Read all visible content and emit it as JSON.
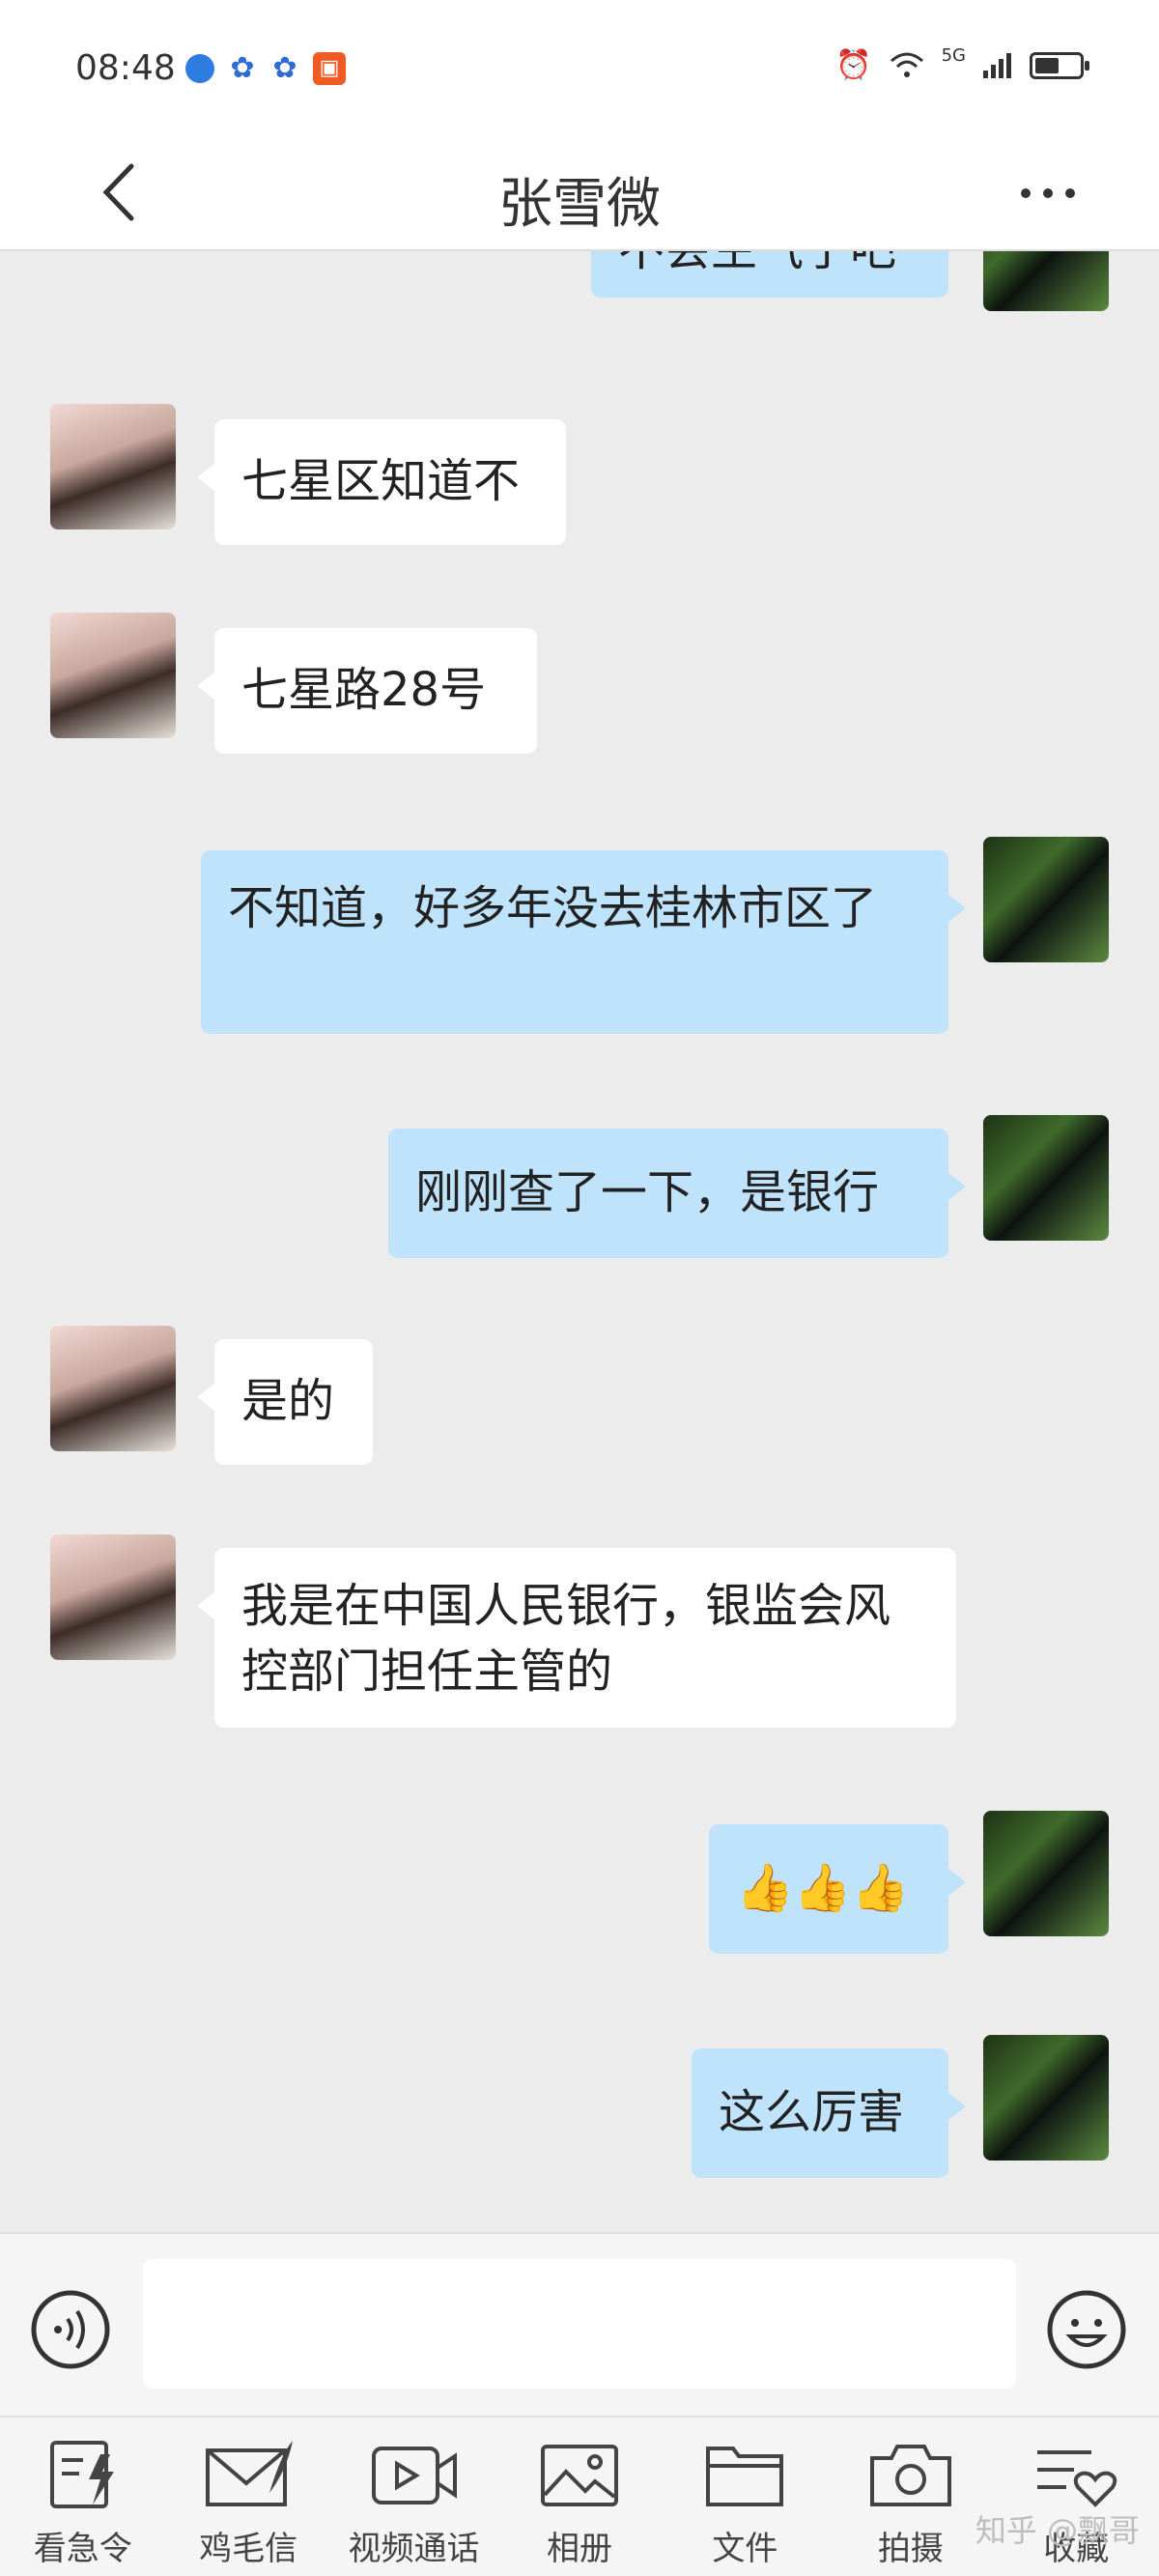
{
  "status_bar": {
    "time": "08:48",
    "network_label": "5G"
  },
  "header": {
    "contact_name": "张雪微"
  },
  "messages": [
    {
      "side": "right",
      "text": "不会生气了吧"
    },
    {
      "side": "left",
      "text": "七星区知道不"
    },
    {
      "side": "left",
      "text": "七星路28号"
    },
    {
      "side": "right",
      "text": "不知道，好多年没去桂林市区了"
    },
    {
      "side": "right",
      "text": "刚刚查了一下，是银行"
    },
    {
      "side": "left",
      "text": "是的"
    },
    {
      "side": "left",
      "text": "我是在中国人民银行，银监会风控部门担任主管的"
    },
    {
      "side": "right",
      "text": "👍👍👍"
    },
    {
      "side": "right",
      "text": "这么厉害"
    }
  ],
  "input": {
    "placeholder": ""
  },
  "toolbar": {
    "items": [
      {
        "label": "看急令",
        "icon": "urgent-note-icon"
      },
      {
        "label": "鸡毛信",
        "icon": "feather-letter-icon"
      },
      {
        "label": "视频通话",
        "icon": "video-call-icon"
      },
      {
        "label": "相册",
        "icon": "photo-album-icon"
      },
      {
        "label": "文件",
        "icon": "folder-icon"
      },
      {
        "label": "拍摄",
        "icon": "camera-icon"
      },
      {
        "label": "收藏",
        "icon": "favorites-icon"
      }
    ]
  },
  "watermark": "知乎 @飘哥",
  "colors": {
    "chat_background": "#ececec",
    "my_bubble": "#bfe3fb",
    "their_bubble": "#ffffff"
  }
}
